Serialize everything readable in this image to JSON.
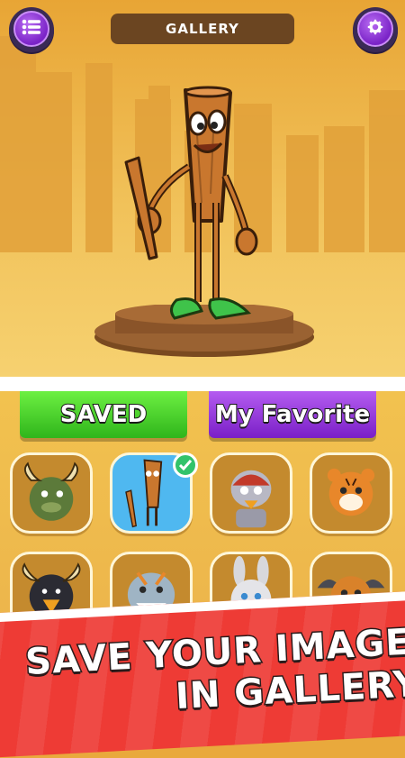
{
  "header": {
    "title": "GALLERY",
    "menu_icon": "list-icon",
    "settings_icon": "gear-icon"
  },
  "tabs": [
    {
      "label": "SAVED"
    },
    {
      "label": "My Favorite"
    }
  ],
  "gallery_items": [
    {
      "subject": "dino-bull"
    },
    {
      "subject": "bat-man",
      "selected": true
    },
    {
      "subject": "armored-duck"
    },
    {
      "subject": "tiger-cub"
    },
    {
      "subject": "horned-crow"
    },
    {
      "subject": "shark-tiger"
    },
    {
      "subject": "bunny"
    },
    {
      "subject": "winged-tiger"
    }
  ],
  "promo": {
    "line1": "SAVE YOUR IMAGES",
    "line2": "IN GALLERY"
  },
  "colors": {
    "accent_purple": "#7a23c7",
    "tab_green": "#2fb51b",
    "banner_red": "#ee3b35",
    "title_brown": "#6b4521"
  }
}
